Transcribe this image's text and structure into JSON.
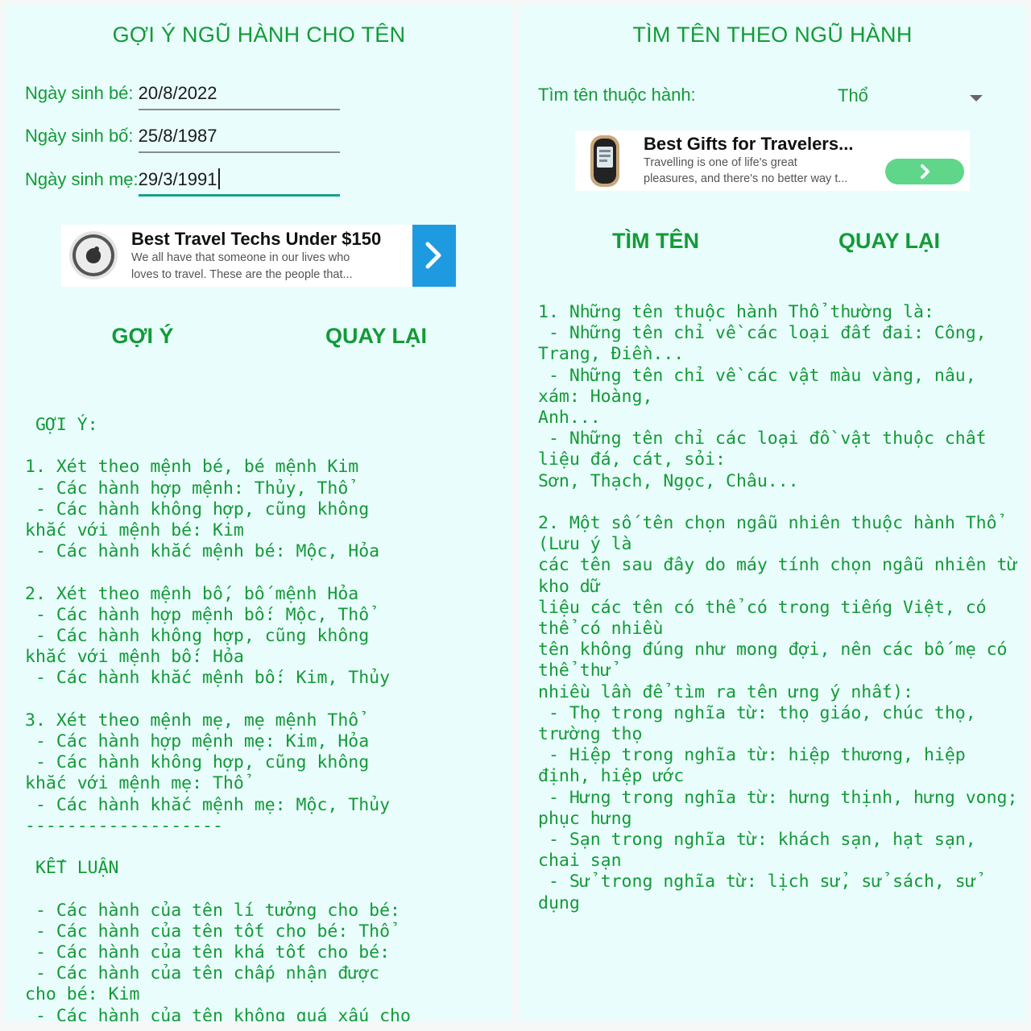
{
  "left": {
    "title": "GỢI Ý NGŨ HÀNH CHO TÊN",
    "fields": [
      {
        "label": "Ngày sinh bé: ",
        "value": "20/8/2022"
      },
      {
        "label": "Ngày sinh bố: ",
        "value": "25/8/1987"
      },
      {
        "label": "Ngày sinh mẹ:",
        "value": "29/3/1991"
      }
    ],
    "ad": {
      "title": "Best Travel Techs Under $150",
      "line1": "We all have that someone in our lives who",
      "line2": "loves to travel. These are the people that...",
      "arrow": "›"
    },
    "suggest_button": "GỢI Ý",
    "back_button": "QUAY LẠI",
    "result_text": " GỢI Ý:\n\n1. Xét theo mệnh bé, bé mệnh Kim\n - Các hành hợp mệnh: Thủy, Thổ\n - Các hành không hợp, cũng không\nkhắc với mệnh bé: Kim\n - Các hành khắc mệnh bé: Mộc, Hỏa\n\n2. Xét theo mệnh bố, bố mệnh Hỏa\n - Các hành hợp mệnh bố: Mộc, Thổ\n - Các hành không hợp, cũng không\nkhắc với mệnh bố: Hỏa\n - Các hành khắc mệnh bố: Kim, Thủy\n\n3. Xét theo mệnh mẹ, mẹ mệnh Thổ\n - Các hành hợp mệnh mẹ: Kim, Hỏa\n - Các hành không hợp, cũng không\nkhắc với mệnh mẹ: Thổ\n - Các hành khắc mệnh mẹ: Mộc, Thủy\n-------------------\n\n KẾT LUẬN\n\n - Các hành của tên lí tưởng cho bé:\n - Các hành của tên tốt cho bé: Thổ\n - Các hành của tên khá tốt cho bé:\n - Các hành của tên chấp nhận được\ncho bé: Kim\n - Các hành của tên không quá xấu cho"
  },
  "right": {
    "title": "TÌM TÊN THEO NGŨ HÀNH",
    "select_label": "Tìm tên thuộc hành:",
    "select_value": "Thổ",
    "ad": {
      "title": "Best Gifts for Travelers...",
      "line1": "Travelling is one of life's great",
      "line2": "pleasures, and there's no better way t...",
      "arrow": "›"
    },
    "find_button": "TÌM TÊN",
    "back_button": "QUAY LẠI",
    "result_text": "1. Những tên thuộc hành Thổ thường là:\n - Những tên chỉ về các loại đất đai: Công, Trang, Điền...\n - Những tên chỉ về các vật màu vàng, nâu, xám: Hoàng,\nAnh...\n - Những tên chỉ các loại đồ vật thuộc chất liệu đá, cát, sỏi:\nSơn, Thạch, Ngọc, Châu...\n\n2. Một số tên chọn ngẫu nhiên thuộc hành Thổ (Lưu ý là\ncác tên sau đây do máy tính chọn ngẫu nhiên từ kho dữ\nliệu các tên có thể có trong tiếng Việt, có thể có nhiều\ntên không đúng như mong đợi, nên các bố mẹ có thể thử\nnhiều lần để tìm ra tên ưng ý nhất):\n - Thọ trong nghĩa từ: thọ giáo, chúc thọ, trường thọ\n - Hiệp trong nghĩa từ: hiệp thương, hiệp định, hiệp ước\n - Hưng trong nghĩa từ: hưng thịnh, hưng vong; phục hưng\n - Sạn trong nghĩa từ: khách sạn, hạt sạn, chai sạn\n - Sử trong nghĩa từ: lịch sử, sử sách, sử dụng"
  },
  "colors": {
    "accent": "#139a37",
    "panel_bg": "#e9fdfc",
    "ad_arrow_blue": "#1e9be0",
    "ad_button_green": "#5fd68a"
  }
}
